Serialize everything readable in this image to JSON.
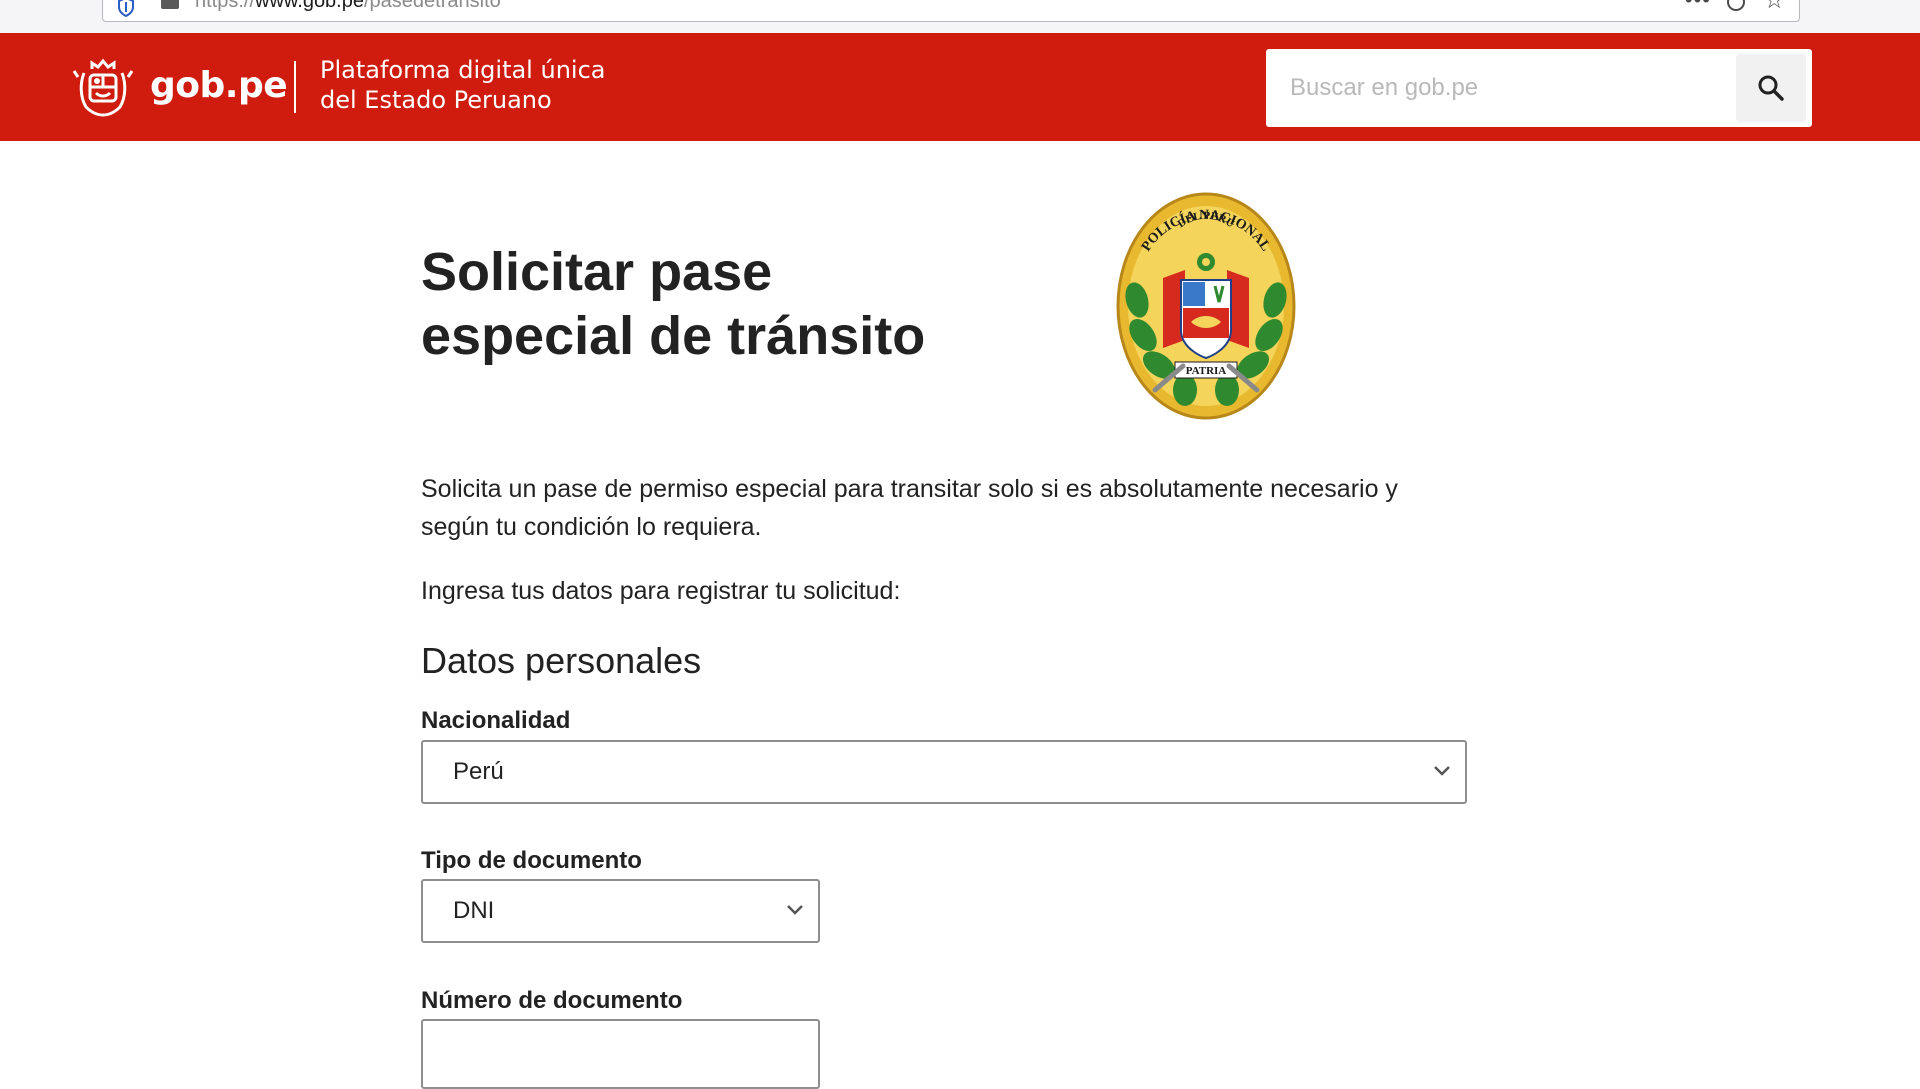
{
  "browser": {
    "url_scheme": "https://",
    "url_host": "www.gob.pe",
    "url_path": "/pasedetransito",
    "more_glyph": "•••",
    "star_glyph": "☆"
  },
  "header": {
    "brand_name": "gob.pe",
    "tagline_line1": "Plataforma digital única",
    "tagline_line2": "del Estado Peruano",
    "search_placeholder": "Buscar en gob.pe",
    "accent_color": "#cf1c0f"
  },
  "main": {
    "title_line1": "Solicitar pase",
    "title_line2": "especial de tránsito",
    "seal_text_top": "POLICÍA NACIONAL",
    "seal_text_mid": "DEL PERÚ",
    "seal_text_banner": "PATRIA",
    "intro": "Solicita un pase de permiso especial para transitar solo si es absolutamente necesario y según tu condición lo requiera.",
    "instruction": "Ingresa tus datos para registrar tu solicitud:",
    "section_title": "Datos personales"
  },
  "form": {
    "nationality": {
      "label": "Nacionalidad",
      "value": "Perú"
    },
    "document_type": {
      "label": "Tipo de documento",
      "value": "DNI"
    },
    "document_number": {
      "label": "Número de documento",
      "value": ""
    }
  }
}
